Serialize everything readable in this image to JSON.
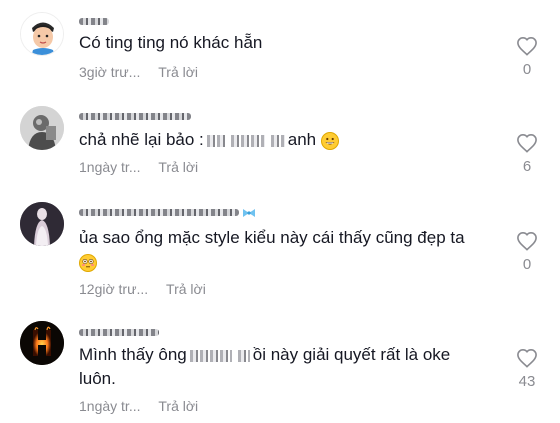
{
  "comments": [
    {
      "text": "Có ting ting nó khác hẵn",
      "time": "3giờ trư...",
      "reply": "Trả lời",
      "likes": "0",
      "avatar": "cartoon-boy-avatar"
    },
    {
      "text_before": "chả nhẽ lại bảo :",
      "text_after": "anh",
      "time": "1ngày tr...",
      "reply": "Trả lời",
      "likes": "6",
      "avatar": "gray-photo-avatar",
      "emoji": "grinning-face-emoji"
    },
    {
      "text_line1": "ủa sao ổng mặc style kiểu này cái thấy cũng đẹp ta",
      "time": "12giờ trư...",
      "reply": "Trả lời",
      "likes": "0",
      "avatar": "woman-photo-avatar",
      "emoji": "flushed-face-emoji"
    },
    {
      "text_line1_before": "Mình thấy ông",
      "text_line1_after": "ồi này giải quyết rất là oke",
      "text_line2": "luôn.",
      "time": "1ngày tr...",
      "reply": "Trả lời",
      "likes": "43",
      "avatar": "fire-letter-h-avatar"
    }
  ],
  "colors": {
    "text": "#161823",
    "muted": "#8a8b91",
    "icon": "#8a8b91"
  }
}
